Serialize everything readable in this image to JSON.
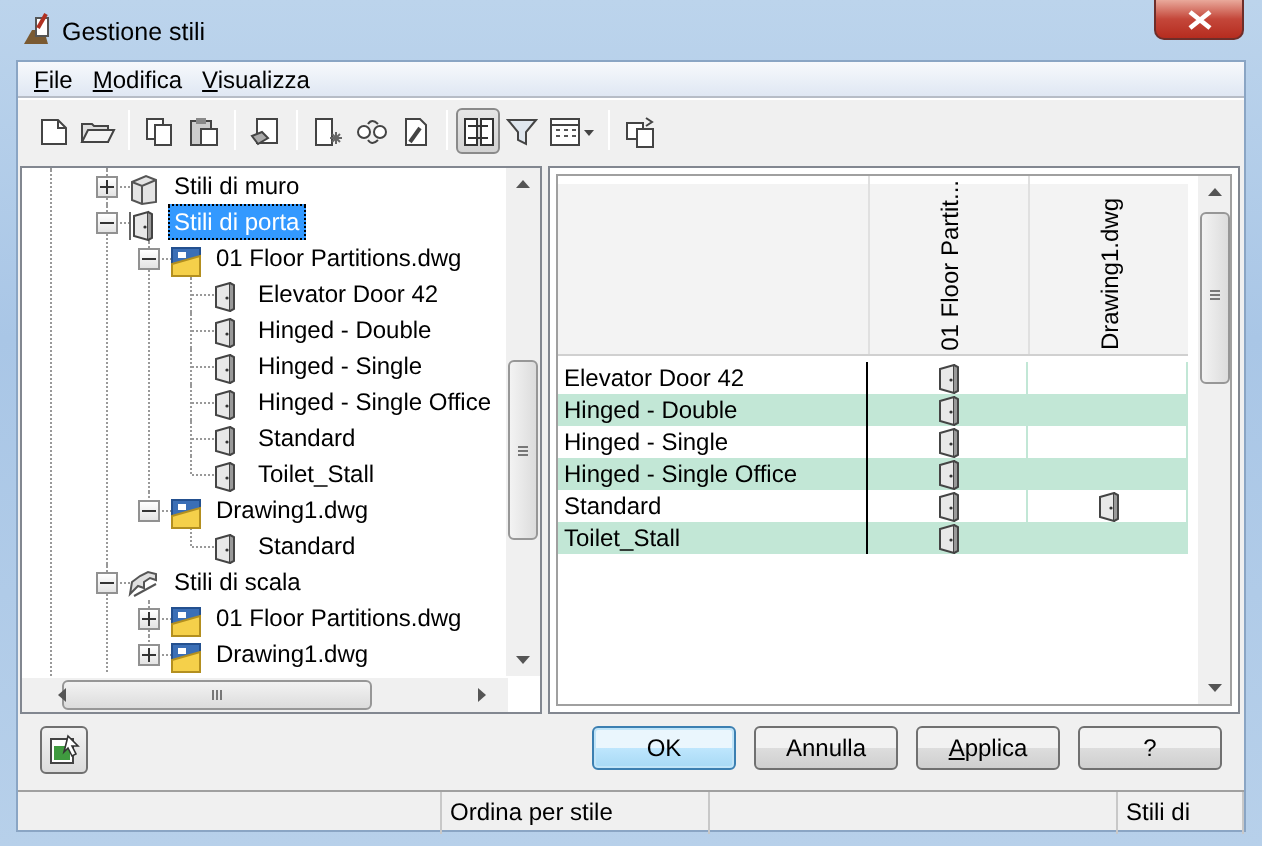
{
  "window": {
    "title": "Gestione stili"
  },
  "menu": [
    {
      "label": "File",
      "underline_first": true
    },
    {
      "label": "Modifica",
      "underline_first": true
    },
    {
      "label": "Visualizza",
      "underline_first": true
    }
  ],
  "toolbar": [
    {
      "kind": "new",
      "pressed": false
    },
    {
      "kind": "open",
      "pressed": false
    },
    {
      "kind": "separator"
    },
    {
      "kind": "copy",
      "pressed": false
    },
    {
      "kind": "paste",
      "pressed": false
    },
    {
      "kind": "separator"
    },
    {
      "kind": "purge",
      "pressed": false
    },
    {
      "kind": "separator"
    },
    {
      "kind": "new-style",
      "pressed": false
    },
    {
      "kind": "link",
      "pressed": false
    },
    {
      "kind": "edit",
      "pressed": false
    },
    {
      "kind": "separator"
    },
    {
      "kind": "compare",
      "pressed": true
    },
    {
      "kind": "filter",
      "pressed": false
    },
    {
      "kind": "view",
      "pressed": false
    },
    {
      "kind": "separator"
    },
    {
      "kind": "sync",
      "pressed": false
    }
  ],
  "tree": [
    {
      "label": "Stili di muro",
      "kind": "wall",
      "expanded": false,
      "selected": false
    },
    {
      "label": "Stili di porta",
      "kind": "door-category",
      "expanded": true,
      "selected": true,
      "children": [
        {
          "label": "01 Floor Partitions.dwg",
          "kind": "drawing",
          "expanded": true,
          "selected": false,
          "children": [
            {
              "label": "Elevator Door 42",
              "kind": "door",
              "selected": false
            },
            {
              "label": "Hinged - Double",
              "kind": "door",
              "selected": false
            },
            {
              "label": "Hinged - Single",
              "kind": "door",
              "selected": false
            },
            {
              "label": "Hinged - Single Office",
              "kind": "door",
              "selected": false
            },
            {
              "label": "Standard",
              "kind": "door",
              "selected": false
            },
            {
              "label": "Toilet_Stall",
              "kind": "door",
              "selected": false
            }
          ]
        },
        {
          "label": "Drawing1.dwg",
          "kind": "drawing",
          "expanded": true,
          "selected": false,
          "children": [
            {
              "label": "Standard",
              "kind": "door",
              "selected": false
            }
          ]
        }
      ]
    },
    {
      "label": "Stili di scala",
      "kind": "stair",
      "expanded": true,
      "selected": false,
      "children": [
        {
          "label": "01 Floor Partitions.dwg",
          "kind": "drawing",
          "expanded": false,
          "selected": false
        },
        {
          "label": "Drawing1.dwg",
          "kind": "drawing",
          "expanded": false,
          "selected": false
        }
      ]
    }
  ],
  "grid": {
    "columns": [
      "01 Floor Partit...",
      "Drawing1.dwg"
    ],
    "rows": [
      {
        "name": "Elevator Door 42",
        "cells": [
          true,
          false
        ]
      },
      {
        "name": "Hinged - Double",
        "cells": [
          true,
          false
        ]
      },
      {
        "name": "Hinged - Single",
        "cells": [
          true,
          false
        ]
      },
      {
        "name": "Hinged - Single Office",
        "cells": [
          true,
          false
        ]
      },
      {
        "name": "Standard",
        "cells": [
          true,
          true
        ]
      },
      {
        "name": "Toilet_Stall",
        "cells": [
          true,
          false
        ]
      }
    ]
  },
  "buttons": [
    {
      "label": "OK",
      "default": true,
      "underline_first": false
    },
    {
      "label": "Annulla",
      "default": false,
      "underline_first": false
    },
    {
      "label": "Applica",
      "default": false,
      "underline_first": true
    },
    {
      "label": "?",
      "default": false,
      "underline_first": false
    }
  ],
  "status_bar": [
    "Ordina per stile",
    "Stili di"
  ]
}
